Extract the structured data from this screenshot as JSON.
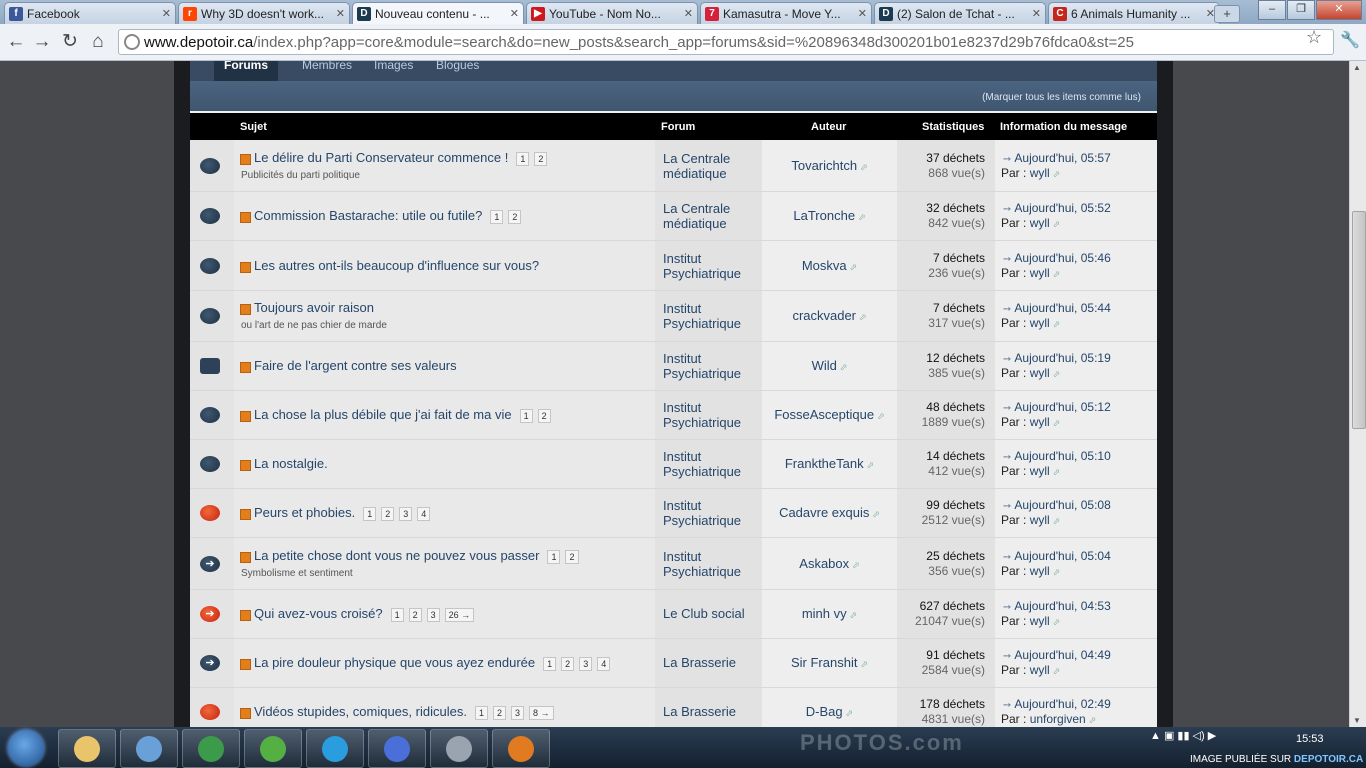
{
  "browser": {
    "tabs": [
      {
        "title": "Facebook",
        "icon": "facebook-icon",
        "color": "#3b5998",
        "glyph": "f"
      },
      {
        "title": "Why 3D doesn't work...",
        "icon": "reddit-icon",
        "color": "#ff4500",
        "glyph": "r"
      },
      {
        "title": "Nouveau contenu - ...",
        "icon": "depotoir-icon",
        "color": "#1b3a4f",
        "glyph": "D",
        "active": true
      },
      {
        "title": "YouTube - Nom No...",
        "icon": "youtube-icon",
        "color": "#cc181e",
        "glyph": "▶"
      },
      {
        "title": "Kamasutra - Move Y...",
        "icon": "seven-icon",
        "color": "#d6213b",
        "glyph": "7"
      },
      {
        "title": "(2) Salon de Tchat - ...",
        "icon": "depotoir-icon",
        "color": "#1b3a4f",
        "glyph": "D"
      },
      {
        "title": "6 Animals Humanity ...",
        "icon": "cracked-icon",
        "color": "#c4261d",
        "glyph": "C"
      }
    ],
    "new_tab": "+",
    "url_host": "www.depotoir.ca",
    "url_path": "/index.php?app=core&module=search&do=new_posts&search_app=forums&sid=%20896348d300201b01e8237d29b76fdca0&st=25"
  },
  "subnav": {
    "tabs": [
      "Forums",
      "Membres",
      "Images",
      "Blogues"
    ]
  },
  "mark_all": "(Marquer tous les items comme lus)",
  "table": {
    "headers": {
      "subject": "Sujet",
      "forum": "Forum",
      "author": "Auteur",
      "stats": "Statistiques",
      "info": "Information du message"
    },
    "rows": [
      {
        "icon": "dark",
        "title": "Le délire du Parti Conservateur commence !",
        "pages": [
          "1",
          "2"
        ],
        "desc": "Publicités du parti politique",
        "forum": [
          "La Centrale",
          "médiatique"
        ],
        "author": "Tovarichtch",
        "replies": "37 déchets",
        "views": "868 vue(s)",
        "last": "Aujourd'hui, 05:57",
        "by_label": "Par :",
        "by": "wyll"
      },
      {
        "icon": "dark",
        "title": "Commission Bastarache: utile ou futile?",
        "pages": [
          "1",
          "2"
        ],
        "desc": "",
        "forum": [
          "La Centrale",
          "médiatique"
        ],
        "author": "LaTronche",
        "replies": "32 déchets",
        "views": "842 vue(s)",
        "last": "Aujourd'hui, 05:52",
        "by_label": "Par :",
        "by": "wyll"
      },
      {
        "icon": "dark",
        "title": "Les autres ont-ils beaucoup d'influence sur vous?",
        "pages": [],
        "desc": "",
        "forum": [
          "Institut",
          "Psychiatrique"
        ],
        "author": "Moskva",
        "replies": "7 déchets",
        "views": "236 vue(s)",
        "last": "Aujourd'hui, 05:46",
        "by_label": "Par :",
        "by": "wyll"
      },
      {
        "icon": "dark",
        "title": "Toujours avoir raison",
        "pages": [],
        "desc": "ou l'art de ne pas chier de marde",
        "forum": [
          "Institut",
          "Psychiatrique"
        ],
        "author": "crackvader",
        "replies": "7 déchets",
        "views": "317 vue(s)",
        "last": "Aujourd'hui, 05:44",
        "by_label": "Par :",
        "by": "wyll"
      },
      {
        "icon": "poll",
        "title": "Faire de l'argent contre ses valeurs",
        "pages": [],
        "desc": "",
        "forum": [
          "Institut",
          "Psychiatrique"
        ],
        "author": "Wild",
        "replies": "12 déchets",
        "views": "385 vue(s)",
        "last": "Aujourd'hui, 05:19",
        "by_label": "Par :",
        "by": "wyll"
      },
      {
        "icon": "dark",
        "title": "La chose la plus débile que j'ai fait de ma vie",
        "pages": [
          "1",
          "2"
        ],
        "desc": "",
        "forum": [
          "Institut",
          "Psychiatrique"
        ],
        "author": "FosseAsceptique",
        "replies": "48 déchets",
        "views": "1889 vue(s)",
        "last": "Aujourd'hui, 05:12",
        "by_label": "Par :",
        "by": "wyll"
      },
      {
        "icon": "dark",
        "title": "La nostalgie.",
        "pages": [],
        "desc": "",
        "forum": [
          "Institut",
          "Psychiatrique"
        ],
        "author": "FranktheTank",
        "replies": "14 déchets",
        "views": "412 vue(s)",
        "last": "Aujourd'hui, 05:10",
        "by_label": "Par :",
        "by": "wyll"
      },
      {
        "icon": "red",
        "title": "Peurs et phobies.",
        "pages": [
          "1",
          "2",
          "3",
          "4"
        ],
        "desc": "",
        "forum": [
          "Institut",
          "Psychiatrique"
        ],
        "author": "Cadavre exquis",
        "replies": "99 déchets",
        "views": "2512 vue(s)",
        "last": "Aujourd'hui, 05:08",
        "by_label": "Par :",
        "by": "wyll"
      },
      {
        "icon": "arrow",
        "title": "La petite chose dont vous ne pouvez vous passer",
        "pages": [
          "1",
          "2"
        ],
        "desc": "Symbolisme et sentiment",
        "forum": [
          "Institut",
          "Psychiatrique"
        ],
        "author": "Askabox",
        "replies": "25 déchets",
        "views": "356 vue(s)",
        "last": "Aujourd'hui, 05:04",
        "by_label": "Par :",
        "by": "wyll"
      },
      {
        "icon": "redarrow",
        "title": "Qui avez-vous croisé?",
        "pages": [
          "1",
          "2",
          "3",
          "26 →"
        ],
        "desc": "",
        "forum": [
          "Le Club social"
        ],
        "author": "minh vy",
        "replies": "627 déchets",
        "views": "21047 vue(s)",
        "last": "Aujourd'hui, 04:53",
        "by_label": "Par :",
        "by": "wyll"
      },
      {
        "icon": "arrow",
        "title": "La pire douleur physique que vous ayez endurée",
        "pages": [
          "1",
          "2",
          "3",
          "4"
        ],
        "desc": "",
        "forum": [
          "La Brasserie"
        ],
        "author": "Sir Franshit",
        "replies": "91 déchets",
        "views": "2584 vue(s)",
        "last": "Aujourd'hui, 04:49",
        "by_label": "Par :",
        "by": "wyll"
      },
      {
        "icon": "red",
        "title": "Vidéos stupides, comiques, ridicules.",
        "pages": [
          "1",
          "2",
          "3",
          "8 →"
        ],
        "desc": "",
        "forum": [
          "La Brasserie"
        ],
        "author": "D-Bag",
        "replies": "178 déchets",
        "views": "4831 vue(s)",
        "last": "Aujourd'hui, 02:49",
        "by_label": "Par :",
        "by": "unforgiven"
      }
    ]
  },
  "taskbar": {
    "apps": [
      "explorer-icon",
      "media-center-icon",
      "chrome-icon",
      "messenger-icon",
      "skype-icon",
      "itunes-icon",
      "steam-icon",
      "media-player-icon"
    ],
    "clock": "15:53",
    "watermark": "IMAGE PUBLIÉE SUR",
    "watermark_brand": "DEPOTOIR.CA",
    "ghost_text": "PHOTOS.com"
  }
}
